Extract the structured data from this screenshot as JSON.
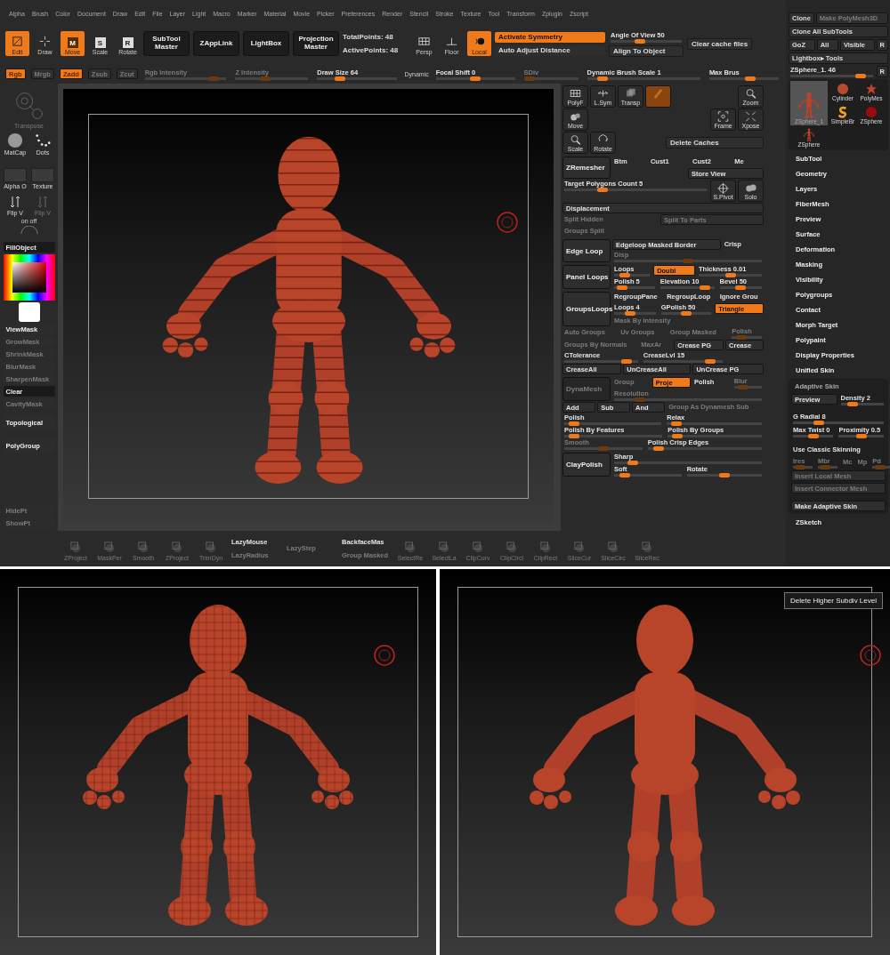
{
  "menu": [
    "Alpha",
    "Brush",
    "Color",
    "Document",
    "Draw",
    "Edit",
    "File",
    "Layer",
    "Light",
    "Macro",
    "Marker",
    "Material",
    "Movie",
    "Picker",
    "Preferences",
    "Render",
    "Stencil",
    "Stroke",
    "Texture",
    "Tool",
    "Transform",
    "Zplugin",
    "Zscript"
  ],
  "toolbar": {
    "modes": [
      {
        "label": "Edit",
        "selected": true
      },
      {
        "label": "Draw",
        "selected": false
      },
      {
        "label": "Move",
        "key": "M",
        "selected": true
      },
      {
        "label": "Scale",
        "key": "S",
        "selected": false
      },
      {
        "label": "Rotate",
        "key": "R",
        "selected": false
      }
    ],
    "big_buttons": [
      "SubTool Master",
      "ZAppLink",
      "LightBox",
      "Projection Master"
    ],
    "stats": [
      "TotalPoints: 48",
      "ActivePoints: 48"
    ],
    "view": [
      {
        "label": "Persp",
        "selected": false
      },
      {
        "label": "Floor",
        "selected": false
      },
      {
        "label": "Local",
        "selected": true
      }
    ],
    "symmetry": [
      {
        "label": "Activate Symmetry",
        "on": true
      },
      {
        "label": "Auto Adjust Distance",
        "on": false
      }
    ],
    "angle": {
      "label": "Angle Of View 50",
      "level": 0.4
    },
    "align": "Align To Object",
    "clear_cache": "Clear cache files"
  },
  "slider_bar": [
    {
      "kind": "toggle",
      "label": "Rgb",
      "on": true,
      "disabled": true
    },
    {
      "kind": "toggle",
      "label": "Mrgb",
      "on": false,
      "disabled": true
    },
    {
      "kind": "toggle",
      "label": "Zadd",
      "on": true,
      "disabled": true
    },
    {
      "kind": "toggle",
      "label": "Zsub",
      "on": false,
      "disabled": true
    },
    {
      "kind": "toggle",
      "label": "Zcut",
      "on": false,
      "disabled": true
    },
    {
      "kind": "slider",
      "label": "Rgb Intensity",
      "level": 0.9,
      "disabled": true
    },
    {
      "kind": "slider",
      "label": "Z Intensity",
      "level": 0.4,
      "disabled": true
    },
    {
      "kind": "slider",
      "label": "Draw Size 64",
      "level": 0.25,
      "disabled": false
    },
    {
      "kind": "tag",
      "label": "Dynamic",
      "disabled": false
    },
    {
      "kind": "slider",
      "label": "Focal Shift 0",
      "level": 0.5,
      "disabled": false
    },
    {
      "kind": "slider",
      "label": "SDiv",
      "level": 0.0,
      "disabled": true
    },
    {
      "kind": "slider",
      "label": "Dynamic Brush Scale 1",
      "level": 0.1,
      "disabled": false
    },
    {
      "kind": "slider",
      "label": "Max Brus",
      "level": 0.6,
      "disabled": false
    }
  ],
  "left_shelf": {
    "transpose": {
      "label": "Transpose",
      "disabled": true
    },
    "materials": [
      {
        "label": "MatCap",
        "kind": "sphere"
      },
      {
        "label": "Dots",
        "kind": "dots"
      }
    ],
    "swatches": [
      "Alpha O",
      "Texture"
    ],
    "flips": [
      {
        "label": "Flip V",
        "disabled": false
      },
      {
        "label": "Flip V",
        "disabled": true
      }
    ],
    "on_off": [
      "on",
      "off"
    ],
    "fill_button": "FillObject",
    "masks": [
      {
        "label": "ViewMask",
        "disabled": false
      },
      {
        "label": "GrowMask",
        "disabled": true
      },
      {
        "label": "ShrinkMask",
        "disabled": true
      },
      {
        "label": "BlurMask",
        "disabled": true
      },
      {
        "label": "SharpenMask",
        "disabled": true
      },
      {
        "label": "Clear",
        "disabled": false
      },
      {
        "label": "CavityMask",
        "disabled": true
      }
    ],
    "topological": "Topological",
    "polygroup": "PolyGroup",
    "points": [
      {
        "label": "HidePt",
        "disabled": true
      },
      {
        "label": "ShowPt",
        "disabled": true
      }
    ]
  },
  "viewport": {
    "kind": "banded"
  },
  "middle": {
    "tools": [
      [
        [
          {
            "kind": "tool",
            "label": "PolyF",
            "on": false
          },
          {
            "kind": "tool",
            "label": "L.Sym",
            "on": false
          },
          {
            "kind": "tool",
            "label": "Transp",
            "on": false
          },
          {
            "kind": "tool",
            "on": true
          }
        ],
        [
          {
            "kind": "tool",
            "label": "Zoom",
            "on": false
          }
        ]
      ],
      [
        [
          {
            "kind": "tool",
            "label": "Move",
            "on": false
          }
        ],
        [
          {
            "kind": "tool",
            "label": "Frame",
            "on": false
          },
          {
            "kind": "tool",
            "label": "Xpose",
            "on": false
          }
        ]
      ],
      [
        [
          {
            "kind": "tool",
            "label": "Scale",
            "on": false
          },
          {
            "kind": "tool",
            "label": "Rotate",
            "on": false
          }
        ],
        [
          {
            "kind": "button",
            "label": "Delete Caches"
          }
        ]
      ]
    ],
    "blocks": [
      {
        "kind": "group",
        "title": "ZRemesher",
        "disabled": false,
        "rows": [
          [
            {
              "kind": "label",
              "label": "Btm",
              "disabled": false
            },
            {
              "kind": "label",
              "label": "Cust1",
              "disabled": false
            },
            {
              "kind": "label",
              "label": "Cust2",
              "disabled": false
            },
            {
              "kind": "label",
              "label": "Me",
              "disabled": false
            }
          ]
        ],
        "side_button": "Store View"
      },
      {
        "kind": "row",
        "cells": [
          {
            "kind": "slider",
            "label": "Target Polygons Count 5",
            "level": 0.25,
            "disabled": false
          },
          {
            "kind": "tool",
            "label": "S.Pivot",
            "disabled": false
          },
          {
            "kind": "tool",
            "label": "Solo",
            "disabled": false
          }
        ]
      },
      {
        "kind": "row",
        "cells": [
          {
            "kind": "button",
            "label": "Displacement",
            "disabled": false
          }
        ]
      },
      {
        "kind": "row",
        "cells": [
          {
            "kind": "label",
            "label": "Split Hidden",
            "disabled": true
          },
          {
            "kind": "button",
            "label": "Split To Parts",
            "disabled": true
          }
        ]
      },
      {
        "kind": "row",
        "cells": [
          {
            "kind": "label",
            "label": "Groups Split",
            "disabled": true
          }
        ]
      },
      {
        "kind": "group",
        "title": "Edge Loop",
        "disabled": false,
        "rows": [
          [
            {
              "kind": "button",
              "label": "Edgeloop Masked Border",
              "disabled": false
            },
            {
              "kind": "label",
              "label": "Crisp",
              "disabled": false
            }
          ],
          [
            {
              "kind": "slider",
              "label": "Disp",
              "level": 0.5,
              "disabled": true
            }
          ]
        ]
      },
      {
        "kind": "group",
        "title": "Panel Loops",
        "disabled": false,
        "rows": [
          [
            {
              "kind": "slider",
              "label": "Loops",
              "level": 0.2,
              "disabled": false
            },
            {
              "kind": "toggle",
              "label": "Doubl",
              "on": true,
              "disabled": false
            },
            {
              "kind": "slider",
              "label": "Thickness 0.01",
              "level": 0.5,
              "disabled": false
            }
          ],
          [
            {
              "kind": "slider",
              "label": "Polish 5",
              "level": 0.1,
              "disabled": false
            },
            {
              "kind": "slider",
              "label": "Elevation 10",
              "level": 0.9,
              "disabled": false
            },
            {
              "kind": "slider",
              "label": "Bevel 50",
              "level": 0.5,
              "disabled": false
            }
          ]
        ]
      },
      {
        "kind": "group",
        "title": "GroupsLoops",
        "disabled": false,
        "rows": [
          [
            {
              "kind": "label",
              "label": "RegroupPane",
              "disabled": false
            },
            {
              "kind": "label",
              "label": "RegroupLoop",
              "disabled": false
            },
            {
              "kind": "label",
              "label": "Ignore Grou",
              "disabled": false
            }
          ],
          [
            {
              "kind": "slider",
              "label": "Loops 4",
              "level": 0.35,
              "disabled": false
            },
            {
              "kind": "slider",
              "label": "GPolish 50",
              "level": 0.5,
              "disabled": false
            },
            {
              "kind": "toggle",
              "label": "Triangle",
              "on": true,
              "disabled": false
            }
          ],
          [
            {
              "kind": "label",
              "label": "Mask By Intensity",
              "disabled": true
            }
          ]
        ]
      },
      {
        "kind": "row",
        "cells": [
          {
            "kind": "label",
            "label": "Auto Groups",
            "disabled": true
          },
          {
            "kind": "label",
            "label": "Uv Groups",
            "disabled": true
          },
          {
            "kind": "label",
            "label": "Group Masked",
            "disabled": true
          },
          {
            "kind": "slider",
            "label": "Polish",
            "level": 0.2,
            "disabled": true
          }
        ]
      },
      {
        "kind": "row",
        "cells": [
          {
            "kind": "label",
            "label": "Groups By Normals",
            "disabled": true
          },
          {
            "kind": "label",
            "label": "MaxAr",
            "disabled": true
          },
          {
            "kind": "button",
            "label": "Crease PG",
            "disabled": false
          },
          {
            "kind": "button",
            "label": "Crease",
            "disabled": false
          }
        ]
      },
      {
        "kind": "row",
        "cells": [
          {
            "kind": "slider",
            "label": "CTolerance",
            "level": 0.9,
            "disabled": false
          },
          {
            "kind": "slider",
            "label": "CreaseLvl 15",
            "level": 0.9,
            "disabled": false
          },
          {
            "kind": "spacer"
          }
        ]
      },
      {
        "kind": "row",
        "cells": [
          {
            "kind": "button",
            "label": "CreaseAll",
            "disabled": false
          },
          {
            "kind": "button",
            "label": "UnCreaseAll",
            "disabled": false
          },
          {
            "kind": "button",
            "label": "UnCrease PG",
            "disabled": false
          }
        ]
      },
      {
        "kind": "group",
        "title": "DynaMesh",
        "disabled": true,
        "rows": [
          [
            {
              "kind": "label",
              "label": "Group",
              "disabled": true
            },
            {
              "kind": "toggle",
              "label": "Proje",
              "on": true,
              "disabled": false
            },
            {
              "kind": "label",
              "label": "Polish",
              "disabled": false
            },
            {
              "kind": "slider",
              "label": "Blur",
              "level": 0.2,
              "disabled": true
            }
          ],
          [
            {
              "kind": "slider",
              "label": "Resolution",
              "level": 0.15,
              "disabled": true
            }
          ]
        ]
      },
      {
        "kind": "row",
        "cells": [
          {
            "kind": "button",
            "label": "Add",
            "disabled": false
          },
          {
            "kind": "button",
            "label": "Sub",
            "disabled": false
          },
          {
            "kind": "button",
            "label": "And",
            "disabled": false
          },
          {
            "kind": "label",
            "label": "Group As Dynamesh Sub",
            "disabled": true
          }
        ]
      },
      {
        "kind": "row",
        "cells": [
          {
            "kind": "slider",
            "label": "Polish",
            "level": 0.05,
            "disabled": false
          },
          {
            "kind": "slider",
            "label": "Relax",
            "level": 0.05,
            "disabled": false
          }
        ]
      },
      {
        "kind": "row",
        "cells": [
          {
            "kind": "slider",
            "label": "Polish By Features",
            "level": 0.05,
            "disabled": false
          },
          {
            "kind": "slider",
            "label": "Polish By Groups",
            "level": 0.05,
            "disabled": false
          }
        ]
      },
      {
        "kind": "row",
        "cells": [
          {
            "kind": "slider",
            "label": "Smooth",
            "level": 0.5,
            "disabled": true
          },
          {
            "kind": "slider",
            "label": "Polish Crisp Edges",
            "level": 0.05,
            "disabled": false
          }
        ]
      },
      {
        "kind": "group",
        "title": "ClayPolish",
        "disabled": false,
        "rows": [
          [
            {
              "kind": "slider",
              "label": "Sharp",
              "level": 0.1,
              "disabled": false
            }
          ],
          [
            {
              "kind": "slider",
              "label": "Soft",
              "level": 0.1,
              "disabled": false
            },
            {
              "kind": "slider",
              "label": "Rotate",
              "level": 0.5,
              "disabled": false
            }
          ]
        ]
      }
    ]
  },
  "shelf": [
    {
      "kind": "icon",
      "label": "ZProject",
      "disabled": true
    },
    {
      "kind": "icon",
      "label": "MaskPer",
      "disabled": true
    },
    {
      "kind": "icon",
      "label": "Smooth",
      "disabled": true
    },
    {
      "kind": "icon",
      "label": "ZProject",
      "disabled": true
    },
    {
      "kind": "icon",
      "label": "TrimDyn",
      "disabled": true
    },
    {
      "kind": "pair",
      "label": "LazyMouse",
      "label2": "LazyRadius",
      "disabled": false
    },
    {
      "kind": "pair",
      "label": "LazyStep",
      "disabled": true
    },
    {
      "kind": "pair",
      "label": "BackfaceMas",
      "label2": "Group Masked",
      "disabled": false
    },
    {
      "kind": "icon",
      "label": "SelectRe",
      "disabled": true
    },
    {
      "kind": "icon",
      "label": "SelectLa",
      "disabled": true
    },
    {
      "kind": "icon",
      "label": "ClipCurv",
      "disabled": true
    },
    {
      "kind": "icon",
      "label": "ClipCircl",
      "disabled": true
    },
    {
      "kind": "icon",
      "label": "ClipRect",
      "disabled": true
    },
    {
      "kind": "icon",
      "label": "SliceCur",
      "disabled": true
    },
    {
      "kind": "icon",
      "label": "SliceCirc",
      "disabled": true
    },
    {
      "kind": "icon",
      "label": "SliceRec",
      "disabled": true
    }
  ],
  "right": {
    "clone": "Clone",
    "polymesh": {
      "label": "Make PolyMesh3D",
      "disabled": true
    },
    "clone_all": "Clone All SubTools",
    "goz": [
      "GoZ",
      "All",
      "Visible",
      "R"
    ],
    "lightbox": "Lightbox▸ Tools",
    "current": {
      "label": "ZSphere_1. 46",
      "level": 0.9
    },
    "current_r": "R",
    "thumbs": [
      {
        "label": "ZSphere_1",
        "kind": "figure",
        "selected": true
      },
      {
        "label": "Cylinder",
        "kind": "sphere",
        "selected": false
      },
      {
        "label": "PolyMes",
        "kind": "star",
        "selected": false
      },
      {
        "label": "SimpleBr",
        "kind": "s",
        "selected": false
      },
      {
        "label": "ZSphere",
        "kind": "ball",
        "selected": false
      },
      {
        "label": "ZSphere",
        "kind": "figure",
        "selected": false
      }
    ],
    "menu_list": [
      "SubTool",
      "Geometry",
      "Layers",
      "FiberMesh",
      "Preview",
      "Surface",
      "Deformation",
      "Masking",
      "Visibility",
      "Polygroups",
      "Contact",
      "Morph Target",
      "Polypaint",
      "Display Properties",
      "Unified Skin"
    ],
    "adaptive_skin": {
      "title": "Adaptive Skin",
      "preview": {
        "kind": "button",
        "label": "Preview",
        "disabled": false
      },
      "density": {
        "kind": "slider",
        "label": "Density 2",
        "level": 0.2,
        "disabled": false
      },
      "radial": {
        "kind": "slider",
        "label": "G Radial 8",
        "level": 0.25,
        "disabled": false
      },
      "twist": {
        "kind": "slider",
        "label": "Max Twist 0",
        "level": 0.5,
        "disabled": false
      },
      "proximity": {
        "kind": "slider",
        "label": "Proximity 0.5",
        "level": 0.5,
        "disabled": false
      },
      "classic": {
        "kind": "label",
        "label": "Use Classic Skinning",
        "disabled": false
      },
      "params": [
        {
          "kind": "slider",
          "label": "Ires",
          "level": 0.2,
          "disabled": true
        },
        {
          "kind": "slider",
          "label": "Mbr",
          "level": 0.2,
          "disabled": true
        },
        {
          "kind": "label",
          "label": "Mc",
          "disabled": true
        },
        {
          "kind": "label",
          "label": "Mp",
          "disabled": true
        },
        {
          "kind": "slider",
          "label": "Pd",
          "level": 0.3,
          "disabled": true
        }
      ],
      "buttons": [
        {
          "kind": "button",
          "label": "Insert Local Mesh",
          "disabled": true
        },
        {
          "kind": "button",
          "label": "Insert Connector Mesh",
          "disabled": true
        },
        {
          "kind": "button",
          "label": "Make Adaptive Skin",
          "disabled": false
        }
      ]
    },
    "zsketch": "ZSketch"
  },
  "renders": [
    {
      "kind": "faceted"
    },
    {
      "kind": "smooth",
      "tooltip": "Delete Higher Subdiv Level"
    }
  ]
}
